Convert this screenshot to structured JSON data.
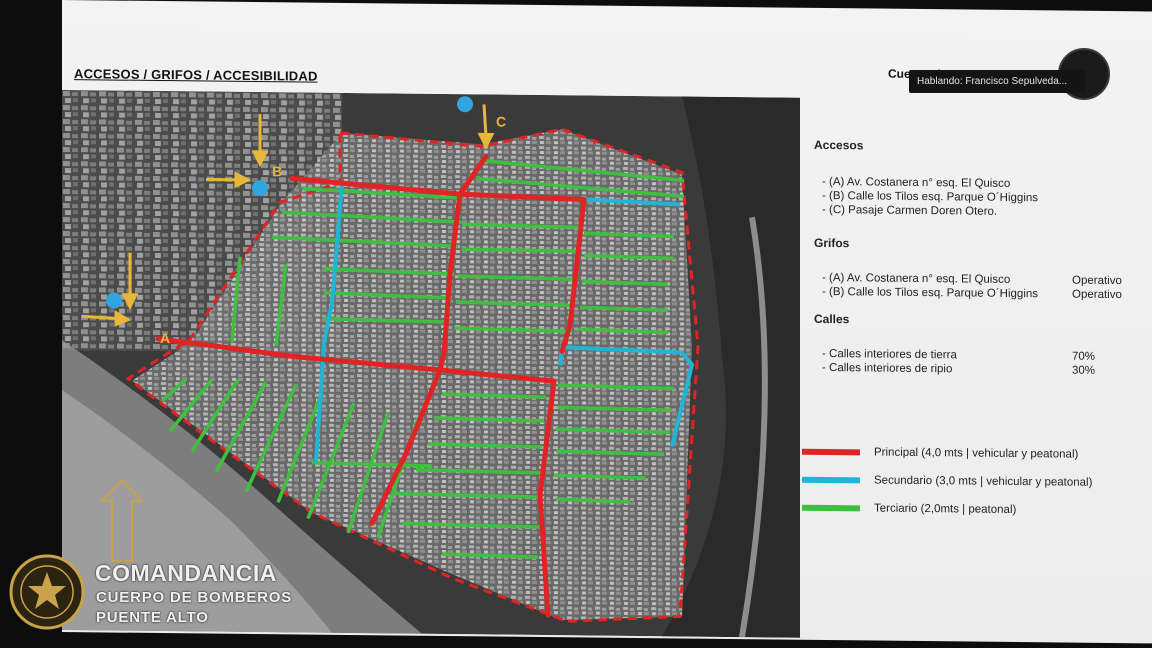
{
  "slide": {
    "title": "ACCESOS / GRIFOS / ACCESIBILIDAD",
    "org_name": "Cuerpo de Bomberos"
  },
  "meeting": {
    "speaker_label": "Hablando: Francisco Sepulveda..."
  },
  "map": {
    "access_labels": [
      "A",
      "B",
      "C"
    ],
    "colors": {
      "principal": "#e02424",
      "secundario": "#1fb5d6",
      "terciario": "#3fbf3f",
      "hydrant": "#2fa6e0",
      "arrow": "#e8b73a"
    }
  },
  "accesos": {
    "heading": "Accesos",
    "items": [
      "-  (A) Av. Costanera n° esq. El Quisco",
      "-  (B) Calle los Tilos esq. Parque O´Higgins",
      "-  (C) Pasaje Carmen Doren Otero."
    ]
  },
  "grifos": {
    "heading": "Grifos",
    "items": [
      {
        "name": "-  (A) Av. Costanera n° esq. El Quisco",
        "status": "Operativo"
      },
      {
        "name": "-  (B) Calle los Tilos esq. Parque O´Higgins",
        "status": "Operativo"
      }
    ]
  },
  "calles": {
    "heading": "Calles",
    "items": [
      {
        "name": "-   Calles interiores de tierra",
        "percent": "70%"
      },
      {
        "name": "-   Calles interiores de ripio",
        "percent": "30%"
      }
    ]
  },
  "legend": [
    {
      "label": "Principal (4,0 mts | vehicular y peatonal)",
      "color": "#e02424"
    },
    {
      "label": "Secundario (3,0 mts | vehicular y peatonal)",
      "color": "#1fb5d6"
    },
    {
      "label": "Terciario (2,0mts | peatonal)",
      "color": "#3fbf3f"
    }
  ],
  "brand": {
    "line1": "COMANDANCIA",
    "line2": "CUERPO DE BOMBEROS",
    "line3": "PUENTE ALTO"
  }
}
